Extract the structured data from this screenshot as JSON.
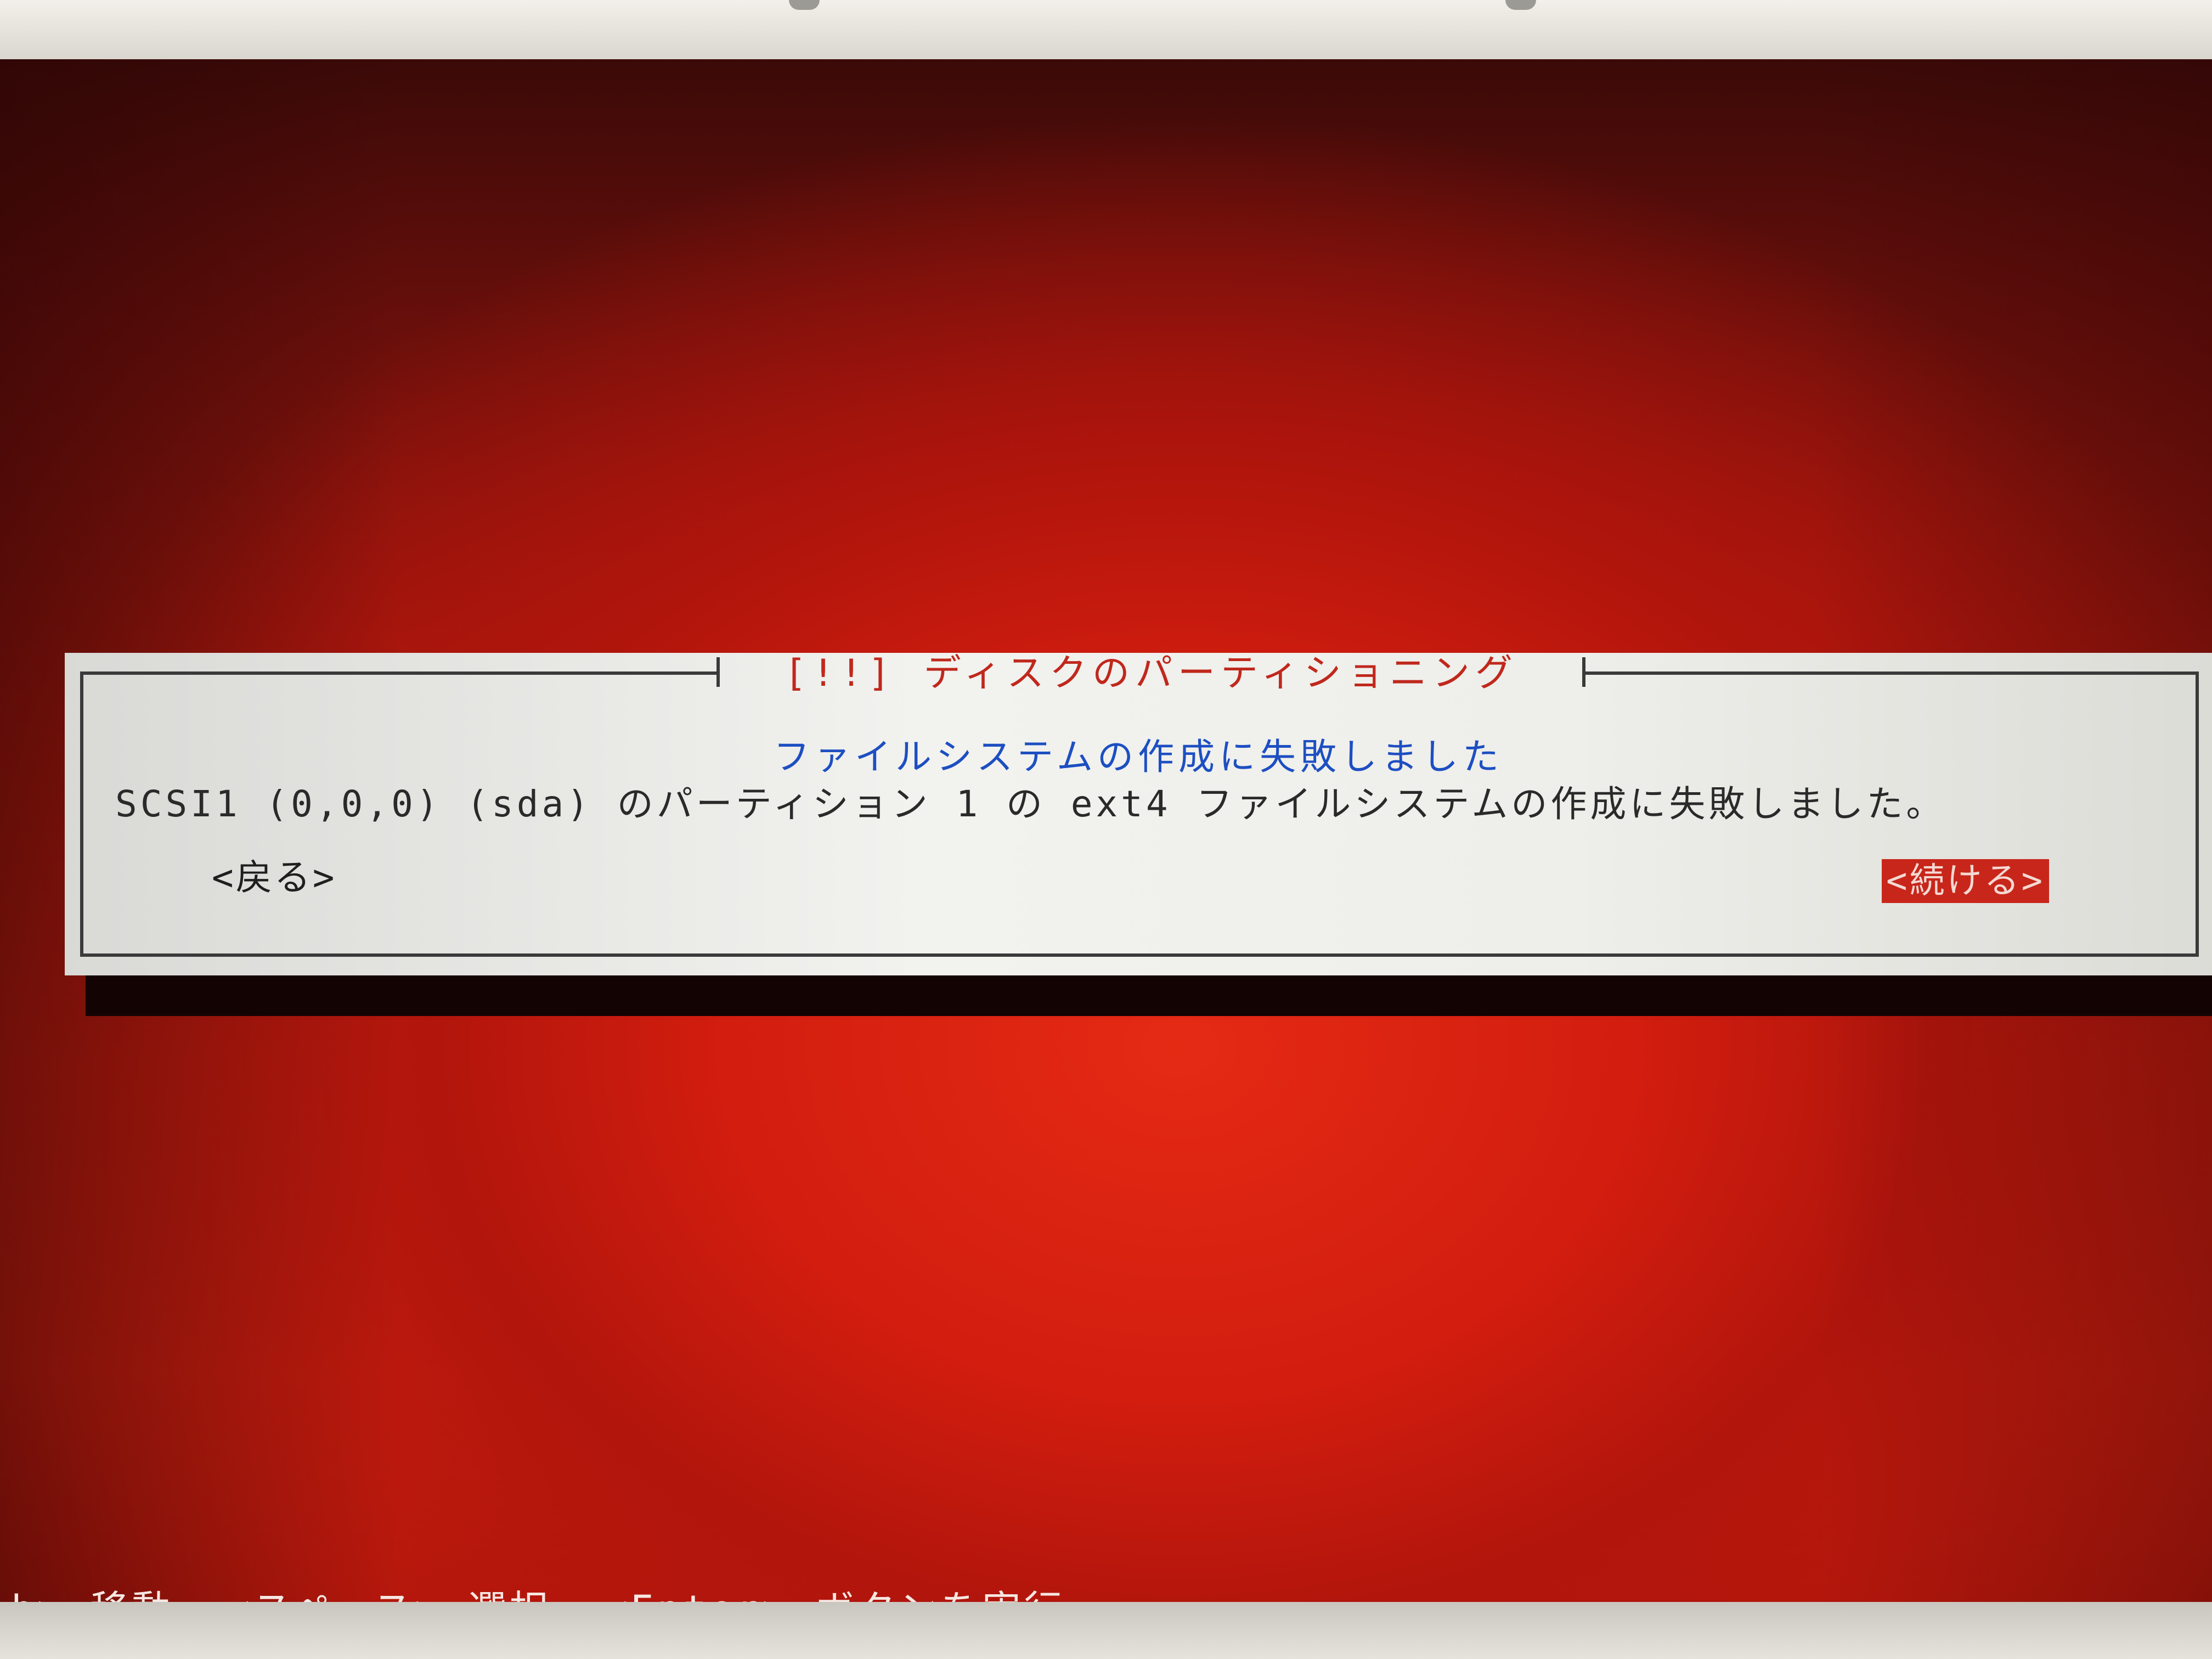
{
  "dialog": {
    "title": "[!!] ディスクのパーティショニング",
    "heading": "ファイルシステムの作成に失敗しました",
    "message": "SCSI1 (0,0,0) (sda) のパーティション 1 の ext4 ファイルシステムの作成に失敗しました。",
    "back_label": "<戻る>",
    "continue_label": "<続ける>"
  },
  "status_line": "ab> 移動; <スペース> 選択; <Enter> ボタンを実行",
  "colors": {
    "background_red": "#d21d0f",
    "dialog_bg": "#eeeeea",
    "title_red": "#c0281c",
    "heading_blue": "#1d4fc2",
    "selected_button_bg": "#c8261a"
  }
}
